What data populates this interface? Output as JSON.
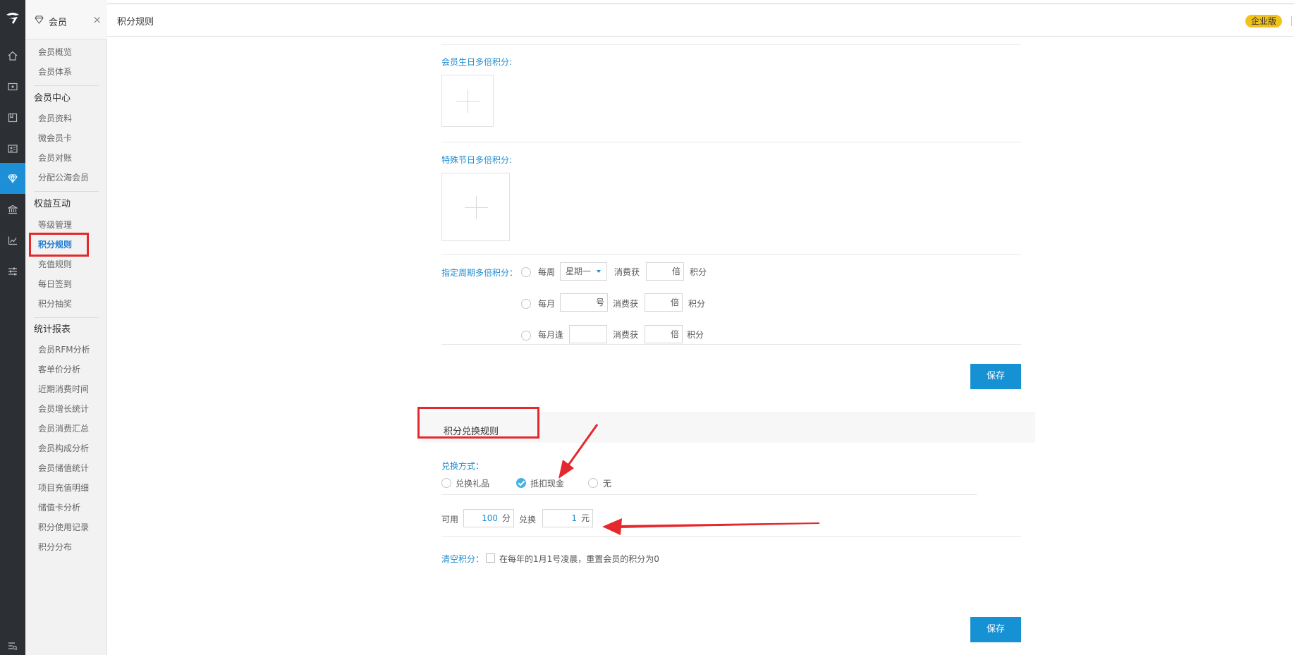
{
  "sidebar": {
    "section_title": "会员",
    "close_symbol": "×",
    "items": [
      {
        "label": "会员概览"
      },
      {
        "label": "会员体系"
      }
    ],
    "groups": [
      {
        "title": "会员中心",
        "items": [
          "会员资料",
          "微会员卡",
          "会员对账",
          "分配公海会员"
        ]
      },
      {
        "title": "权益互动",
        "items": [
          "等级管理",
          "积分规则",
          "充值规则",
          "每日签到",
          "积分抽奖"
        ]
      },
      {
        "title": "统计报表",
        "items": [
          "会员RFM分析",
          "客单价分析",
          "近期消费时间",
          "会员增长统计",
          "会员消费汇总",
          "会员构成分析",
          "会员储值统计",
          "项目充值明细",
          "储值卡分析",
          "积分使用记录",
          "积分分布"
        ]
      }
    ],
    "active_item": "积分规则"
  },
  "rail_icons": [
    "logo-icon",
    "home-icon",
    "wallet-icon",
    "book-icon",
    "contact-card-icon",
    "diamond-icon",
    "bank-icon",
    "chart-icon",
    "sliders-icon",
    "bottom-menu-icon"
  ],
  "header": {
    "title": "积分规则",
    "edition_badge": "企业版"
  },
  "birthday": {
    "label": "会员生日多倍积分:"
  },
  "holiday": {
    "label": "特殊节日多倍积分:"
  },
  "period": {
    "label": "指定周期多倍积分：",
    "rows": [
      {
        "prefix": "每周",
        "select_value": "星期一",
        "mid": "消费获",
        "mult_unit": "倍",
        "suffix": "积分"
      },
      {
        "prefix": "每月",
        "day_unit": "号",
        "mid": "消费获",
        "mult_unit": "倍",
        "suffix": "积分"
      },
      {
        "prefix": "每月逢",
        "mid": "消费获",
        "mult_unit": "倍",
        "suffix": "积分"
      }
    ]
  },
  "save_label": "保存",
  "exchange": {
    "section_title": "积分兑换规则",
    "method_label": "兑换方式：",
    "options": [
      "兑换礼品",
      "抵扣现金",
      "无"
    ],
    "selected": "抵扣现金",
    "available_label": "可用",
    "points_value": "100",
    "points_unit": "分",
    "exchange_label": "兑换",
    "cash_value": "1",
    "cash_unit": "元"
  },
  "clear": {
    "label": "清空积分：",
    "checkbox_text": "在每年的1月1号凌晨，重置会员的积分为0"
  },
  "colors": {
    "accent": "#1591d4",
    "highlight": "#e5282c",
    "badge": "#f2c21b",
    "rail": "#2c2f33"
  }
}
